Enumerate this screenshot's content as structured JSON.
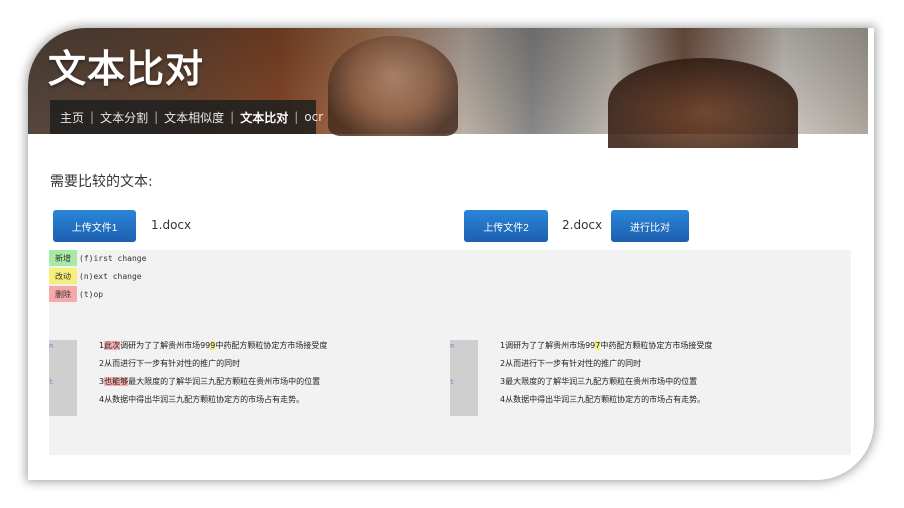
{
  "header": {
    "title": "文本比对",
    "nav": [
      {
        "label": "主页",
        "active": false
      },
      {
        "label": "文本分割",
        "active": false
      },
      {
        "label": "文本相似度",
        "active": false
      },
      {
        "label": "文本比对",
        "active": true
      },
      {
        "label": "ocr",
        "active": false
      }
    ]
  },
  "main": {
    "section_title": "需要比较的文本:",
    "upload1_label": "上传文件1",
    "file1_name": "1.docx",
    "upload2_label": "上传文件2",
    "file2_name": "2.docx",
    "compare_label": "进行比对"
  },
  "legend": [
    {
      "tag": "新增",
      "text": "(f)irst change",
      "color": "#a6eaa6"
    },
    {
      "tag": "改动",
      "text": "(n)ext change",
      "color": "#f6f07a"
    },
    {
      "tag": "删除",
      "text": "(t)op",
      "color": "#f7a8a8"
    }
  ],
  "left_pane": {
    "gutter_glyphs": [
      "n",
      "",
      "t",
      ""
    ],
    "lines": [
      {
        "num": "1",
        "parts": [
          {
            "t": "此次",
            "hl": "del"
          },
          {
            "t": "调研为了了解贵州市场99",
            "hl": ""
          },
          {
            "t": "9",
            "hl": "chg"
          },
          {
            "t": "中药配方颗粒协定方市场接受度",
            "hl": ""
          }
        ]
      },
      {
        "num": "2",
        "parts": [
          {
            "t": "从而进行下一步有针对性的推广的同时",
            "hl": ""
          }
        ]
      },
      {
        "num": "3",
        "parts": [
          {
            "t": "也能够",
            "hl": "del"
          },
          {
            "t": "最大限度的了解华润三九配方颗粒在贵州市场中的位置",
            "hl": ""
          }
        ]
      },
      {
        "num": "4",
        "parts": [
          {
            "t": "从数据中得出华润三九配方颗粒协定方的市场占有走势。",
            "hl": ""
          }
        ]
      }
    ]
  },
  "right_pane": {
    "gutter_glyphs": [
      "n",
      "",
      "t",
      ""
    ],
    "lines": [
      {
        "num": "1",
        "parts": [
          {
            "t": "调研为了了解贵州市场99",
            "hl": ""
          },
          {
            "t": "7",
            "hl": "chg"
          },
          {
            "t": "中药配方颗粒协定方市场接受度",
            "hl": ""
          }
        ]
      },
      {
        "num": "2",
        "parts": [
          {
            "t": "从而进行下一步有针对性的推广的同时",
            "hl": ""
          }
        ]
      },
      {
        "num": "3",
        "parts": [
          {
            "t": "最大限度的了解华润三九配方颗粒在贵州市场中的位置",
            "hl": ""
          }
        ]
      },
      {
        "num": "4",
        "parts": [
          {
            "t": "从数据中得出华润三九配方颗粒协定方的市场占有走势。",
            "hl": ""
          }
        ]
      }
    ]
  }
}
